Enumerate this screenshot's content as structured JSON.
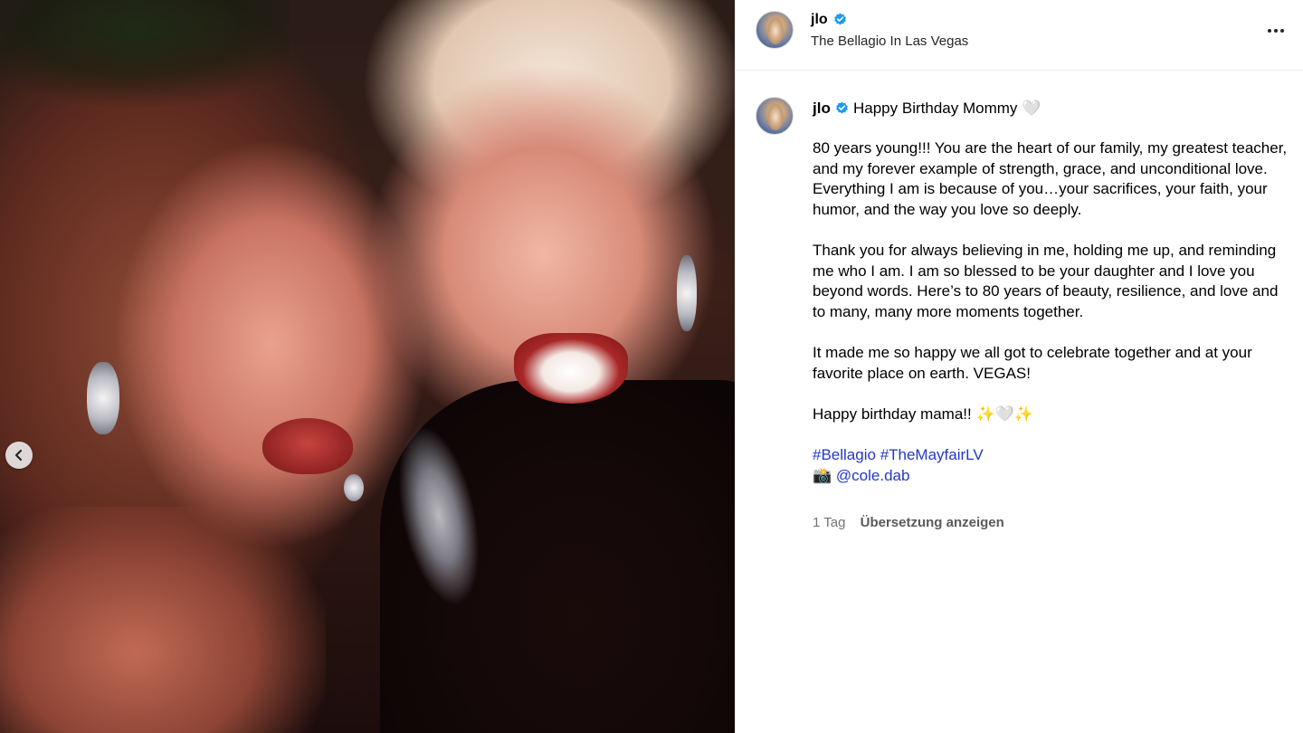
{
  "post": {
    "username": "jlo",
    "verified": true,
    "location": "The Bellagio In Las Vegas",
    "caption": {
      "headline": "Happy Birthday Mommy",
      "headline_emoji": "🤍",
      "paragraphs": [
        "80 years young!!! You are the heart of our family, my greatest teacher, and my forever example of strength, grace, and unconditional love. Everything I am is because of you…your sacrifices, your faith, your humor, and the way you love so deeply.",
        "Thank you for always believing in me, holding me up, and reminding me who I am. I am so blessed to be your daughter and I love you beyond words. Here’s to 80 years of beauty, resilience, and love and to many, many more moments together.",
        "It made me so happy we all got to celebrate together and at your favorite place on earth. VEGAS!"
      ],
      "closing_text": "Happy birthday mama!!",
      "closing_emojis": [
        "✨",
        "🤍",
        "✨"
      ],
      "hashtags": [
        "#Bellagio",
        "#TheMayfairLV"
      ],
      "photo_credit_emoji": "📸",
      "photo_credit": "@cole.dab"
    },
    "timestamp": "1 Tag",
    "translate_label": "Übersetzung anzeigen"
  },
  "icons": {
    "verified": "verified-badge-icon",
    "more": "more-options-icon",
    "carousel_prev": "chevron-left-icon"
  },
  "colors": {
    "verified_blue": "#1d9bf0",
    "link_blue": "#2437c9",
    "meta_gray": "#737373"
  }
}
